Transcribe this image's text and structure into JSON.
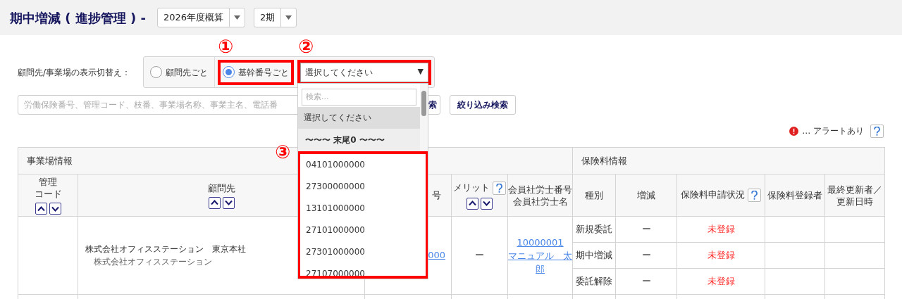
{
  "header": {
    "title": "期中増減 ( 進捗管理 ) -",
    "selects": [
      {
        "value": "2026年度概算"
      },
      {
        "value": "2期"
      }
    ]
  },
  "display_switch": {
    "label": "顧問先/事業場の表示切替え：",
    "options": [
      {
        "label": "顧問先ごと",
        "selected": false
      },
      {
        "label": "基幹番号ごと",
        "selected": true
      }
    ],
    "select": {
      "value": "選択してください",
      "arrow": "▼",
      "expanded": true
    }
  },
  "dropdown": {
    "search_placeholder": "検索...",
    "items": [
      {
        "kind": "option",
        "label": "選択してください",
        "selected": true
      },
      {
        "kind": "group",
        "label": "〜〜〜 末尾0 〜〜〜"
      },
      {
        "kind": "option",
        "label": "04101000000",
        "selected": false
      },
      {
        "kind": "option",
        "label": "27300000000",
        "selected": false
      },
      {
        "kind": "option",
        "label": "13101000000",
        "selected": false
      },
      {
        "kind": "option",
        "label": "27101000000",
        "selected": false
      },
      {
        "kind": "option",
        "label": "27301000000",
        "selected": false
      },
      {
        "kind": "option",
        "label": "27107000000",
        "selected": false
      }
    ]
  },
  "search": {
    "placeholder": "労働保険番号、管理コード、枝番、事業場名称、事業主名、電話番",
    "search_button": "索",
    "filter_button": "絞り込み検索"
  },
  "legend": {
    "text": "… アラートあり"
  },
  "table": {
    "groups": [
      {
        "label": "事業場情報"
      },
      {
        "label": "保険料情報"
      }
    ],
    "columns": [
      {
        "lines": [
          "管理",
          "コード"
        ],
        "sortable": true,
        "help": false
      },
      {
        "lines": [
          "顧問先"
        ],
        "sortable": true,
        "help": false
      },
      {
        "lines": [
          "号"
        ],
        "sortable": false,
        "help": false
      },
      {
        "lines": [
          "メリット"
        ],
        "sortable": true,
        "help": true
      },
      {
        "lines": [
          "会員社労士番号",
          "会員社労士名"
        ],
        "sortable": false,
        "help": false
      },
      {
        "lines": [
          "種別"
        ],
        "sortable": false,
        "help": false
      },
      {
        "lines": [
          "増減"
        ],
        "sortable": false,
        "help": false
      },
      {
        "lines": [
          "保険料申請状況"
        ],
        "sortable": false,
        "help": true
      },
      {
        "lines": [
          "保険料登録者"
        ],
        "sortable": false,
        "help": false
      },
      {
        "lines": [
          "最終更新者／",
          "更新日時"
        ],
        "sortable": false,
        "help": false
      }
    ],
    "rows": [
      {
        "client": "株式会社オフィスステーション　東京本社",
        "client_sub": "株式会社オフィスステーション",
        "number_link": "000",
        "merit": "ー",
        "member_link": [
          "10000001",
          "マニュアル　太郎"
        ],
        "insurance": [
          {
            "type": "新規委託",
            "change": "ー",
            "status": "未登録"
          },
          {
            "type": "期中増減",
            "change": "ー",
            "status": "未登録"
          },
          {
            "type": "委託解除",
            "change": "ー",
            "status": "未登録"
          }
        ]
      }
    ]
  },
  "annotations": [
    {
      "label": "①"
    },
    {
      "label": "②"
    },
    {
      "label": "③"
    }
  ]
}
